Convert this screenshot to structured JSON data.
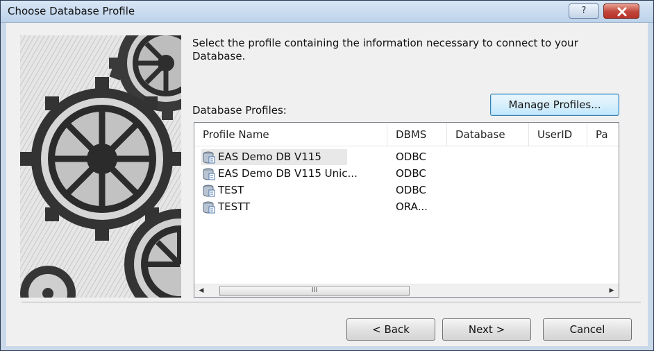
{
  "window": {
    "title": "Choose Database Profile",
    "help_label": "?"
  },
  "intro_text": "Select the profile containing the information necessary to connect to your Database.",
  "manage_profiles_label": "Manage Profiles...",
  "profiles_label": "Database Profiles:",
  "list": {
    "columns": [
      "Profile Name",
      "DBMS",
      "Database",
      "UserID",
      "Pa"
    ],
    "rows": [
      {
        "name": "EAS Demo DB V115",
        "dbms": "ODBC",
        "selected": true
      },
      {
        "name": "EAS Demo DB V115 Unic...",
        "dbms": "ODBC",
        "selected": false
      },
      {
        "name": "TEST",
        "dbms": "ODBC",
        "selected": false
      },
      {
        "name": "TESTT",
        "dbms": "ORA...",
        "selected": false
      }
    ],
    "scroll_thumb_grip": "III"
  },
  "buttons": {
    "back": "< Back",
    "next": "Next >",
    "cancel": "Cancel"
  },
  "colors": {
    "titlebar": "#c9d9ea",
    "close_button": "#c0453a",
    "dialog_background": "#f0f0f0"
  }
}
